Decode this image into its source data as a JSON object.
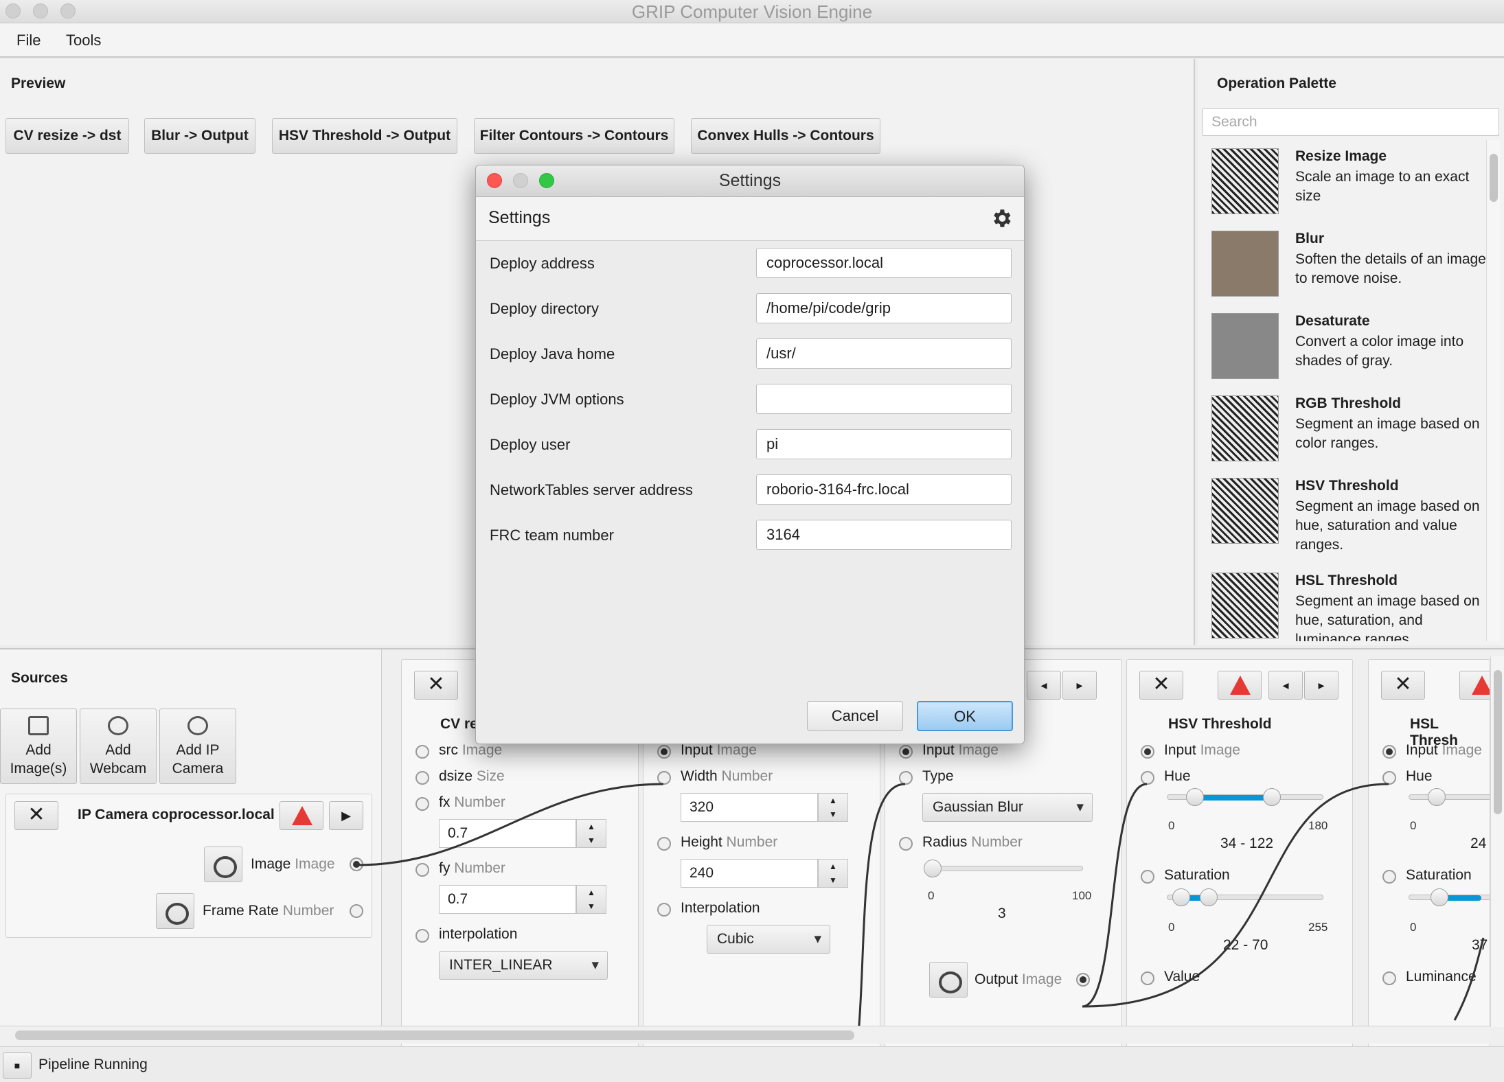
{
  "window": {
    "title": "GRIP Computer Vision Engine"
  },
  "menu": [
    "File",
    "Tools"
  ],
  "preview": {
    "title": "Preview",
    "tabs": [
      "CV resize -> dst",
      "Blur -> Output",
      "HSV Threshold -> Output",
      "Filter Contours -> Contours",
      "Convex Hulls -> Contours"
    ]
  },
  "palette": {
    "title": "Operation Palette",
    "search_placeholder": "Search",
    "ops": [
      {
        "name": "Resize Image",
        "desc": "Scale an image to an exact size"
      },
      {
        "name": "Blur",
        "desc": "Soften the details of an image to remove noise."
      },
      {
        "name": "Desaturate",
        "desc": "Convert a color image into shades of gray."
      },
      {
        "name": "RGB Threshold",
        "desc": "Segment an image based on color ranges."
      },
      {
        "name": "HSV Threshold",
        "desc": "Segment an image based on hue, saturation and value ranges."
      },
      {
        "name": "HSL Threshold",
        "desc": "Segment an image based on hue, saturation, and luminance ranges."
      }
    ]
  },
  "sources": {
    "title": "Sources",
    "buttons": [
      "Add Image(s)",
      "Add Webcam",
      "Add IP Camera"
    ],
    "camera": {
      "name": "IP Camera coprocessor.local",
      "outputs": [
        {
          "label": "Image",
          "type": "Image"
        },
        {
          "label": "Frame Rate",
          "type": "Number"
        }
      ]
    }
  },
  "steps": {
    "cv_resize": {
      "title": "CV re",
      "src": "src",
      "src_type": "Image",
      "dsize": "dsize",
      "dsize_type": "Size",
      "fx": "fx",
      "fx_type": "Number",
      "fx_value": "0.7",
      "fy": "fy",
      "fy_type": "Number",
      "fy_value": "0.7",
      "interp": "interpolation",
      "interp_value": "INTER_LINEAR"
    },
    "resize": {
      "input": "Input",
      "input_type": "Image",
      "width": "Width",
      "width_type": "Number",
      "width_value": "320",
      "height": "Height",
      "height_type": "Number",
      "height_value": "240",
      "interp": "Interpolation",
      "interp_value": "Cubic"
    },
    "blur": {
      "input": "Input",
      "input_type": "Image",
      "type": "Type",
      "type_value": "Gaussian Blur",
      "radius": "Radius",
      "radius_type": "Number",
      "min": "0",
      "max": "100",
      "value": "3",
      "output": "Output",
      "output_type": "Image"
    },
    "hsv": {
      "title": "HSV Threshold",
      "input": "Input",
      "input_type": "Image",
      "hue": "Hue",
      "hue_min": "0",
      "hue_max": "180",
      "hue_value": "34 - 122",
      "sat": "Saturation",
      "sat_min": "0",
      "sat_max": "255",
      "sat_value": "22 - 70",
      "val": "Value"
    },
    "hsl": {
      "title": "HSL Thresh",
      "input": "Input",
      "input_type": "Image",
      "hue": "Hue",
      "hue_min": "0",
      "hue_value": "24",
      "sat": "Saturation",
      "sat_min": "0",
      "sat_value": "37",
      "lum": "Luminance"
    }
  },
  "status": {
    "text": "Pipeline Running"
  },
  "dialog": {
    "title": "Settings",
    "header": "Settings",
    "fields": [
      {
        "label": "Deploy address",
        "value": "coprocessor.local"
      },
      {
        "label": "Deploy directory",
        "value": "/home/pi/code/grip"
      },
      {
        "label": "Deploy Java home",
        "value": "/usr/"
      },
      {
        "label": "Deploy JVM options",
        "value": ""
      },
      {
        "label": "Deploy user",
        "value": "pi"
      },
      {
        "label": "NetworkTables server address",
        "value": "roborio-3164-frc.local"
      },
      {
        "label": "FRC team number",
        "value": "3164"
      }
    ],
    "cancel": "Cancel",
    "ok": "OK"
  },
  "colors": {
    "accent": "#0796d6",
    "warning": "#e53935",
    "close": "#fc5753",
    "zoom": "#33c748"
  }
}
